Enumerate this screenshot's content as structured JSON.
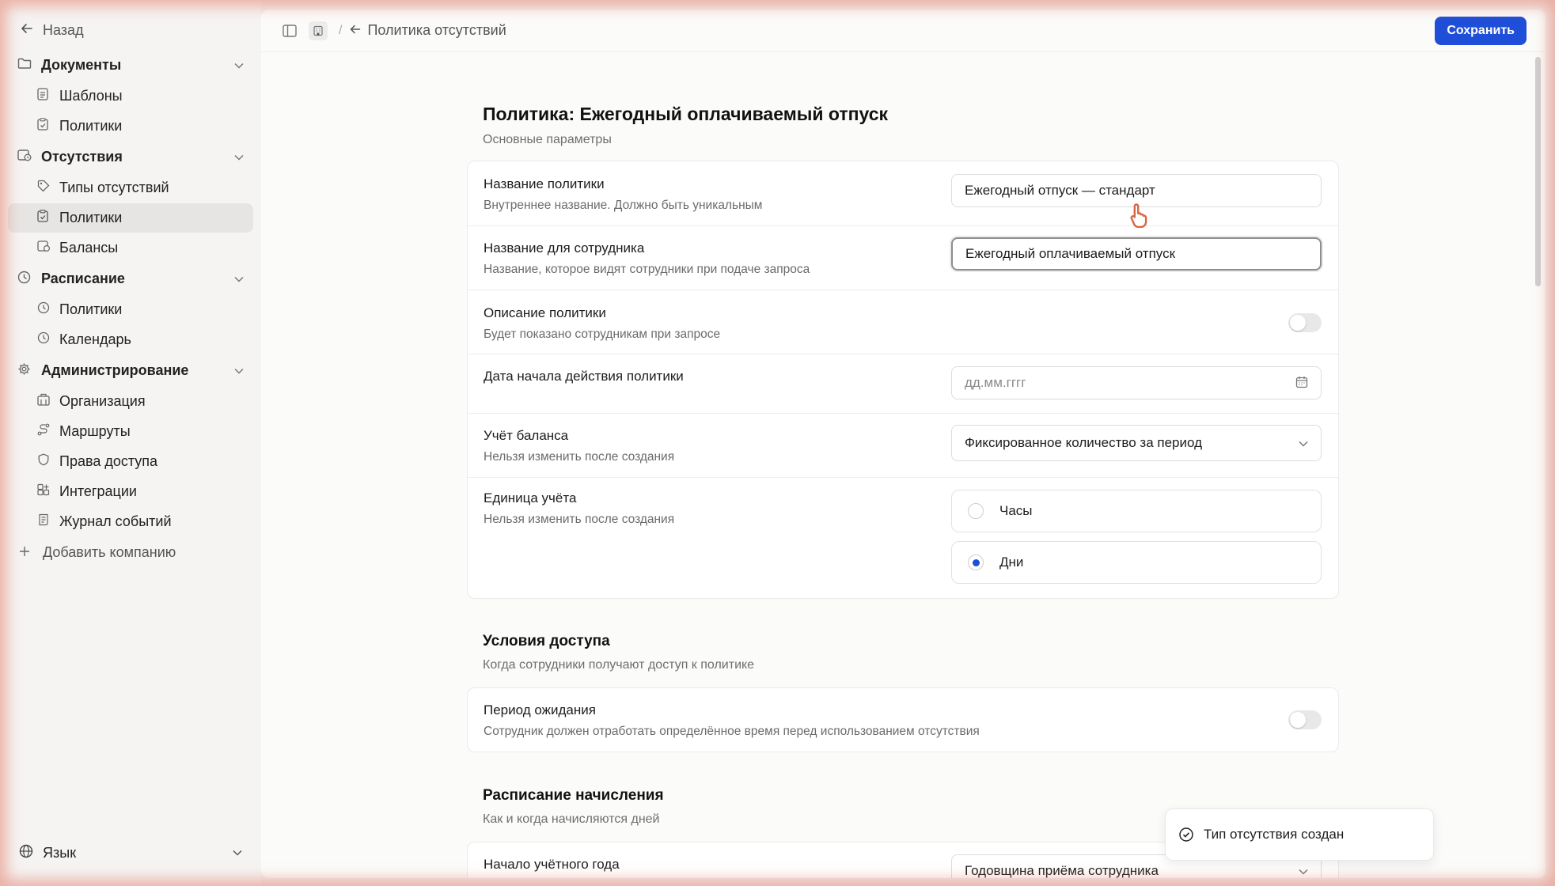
{
  "sidebar": {
    "back_label": "Назад",
    "groups": [
      {
        "label": "Документы",
        "items": [
          "Шаблоны",
          "Политики"
        ]
      },
      {
        "label": "Отсутствия",
        "items": [
          "Типы отсутствий",
          "Политики",
          "Балансы"
        ]
      },
      {
        "label": "Расписание",
        "items": [
          "Политики",
          "Календарь"
        ]
      },
      {
        "label": "Администрирование",
        "items": [
          "Организация",
          "Маршруты",
          "Права доступа",
          "Интеграции",
          "Журнал событий"
        ]
      }
    ],
    "active_item": "Отсутствия / Политики",
    "add_company": "Добавить компанию",
    "language": "Язык"
  },
  "topbar": {
    "breadcrumb": "Политика отсутствий",
    "save_label": "Сохранить"
  },
  "page": {
    "title": "Политика: Ежегодный оплачиваемый отпуск",
    "subtitle": "Основные параметры"
  },
  "form": {
    "policy_name": {
      "label": "Название политики",
      "hint": "Внутреннее название. Должно быть уникальным",
      "value": "Ежегодный отпуск — стандарт"
    },
    "employee_name": {
      "label": "Название для сотрудника",
      "hint": "Название, которое видят сотрудники при подаче запроса",
      "value": "Ежегодный оплачиваемый отпуск"
    },
    "description": {
      "label": "Описание политики",
      "hint": "Будет показано сотрудникам при запросе",
      "enabled": false
    },
    "start_date": {
      "label": "Дата начала действия политики",
      "placeholder": "дд.мм.гггг"
    },
    "balance": {
      "label": "Учёт баланса",
      "hint": "Нельзя изменить после создания",
      "value": "Фиксированное количество за период"
    },
    "unit": {
      "label": "Единица учёта",
      "hint": "Нельзя изменить после создания",
      "options": [
        "Часы",
        "Дни"
      ],
      "selected": "Дни"
    }
  },
  "access": {
    "title": "Условия доступа",
    "subtitle": "Когда сотрудники получают доступ к политике",
    "waiting": {
      "label": "Период ожидания",
      "hint": "Сотрудник должен отработать определённое время перед использованием отсутствия",
      "enabled": false
    }
  },
  "accrual": {
    "title": "Расписание начисления",
    "subtitle": "Как и когда начисляются дней",
    "year_start": {
      "label": "Начало учётного года",
      "value": "Годовщина приёма сотрудника"
    }
  },
  "toast": {
    "message": "Тип отсутствия создан"
  },
  "colors": {
    "accent": "#1f4fd8"
  }
}
